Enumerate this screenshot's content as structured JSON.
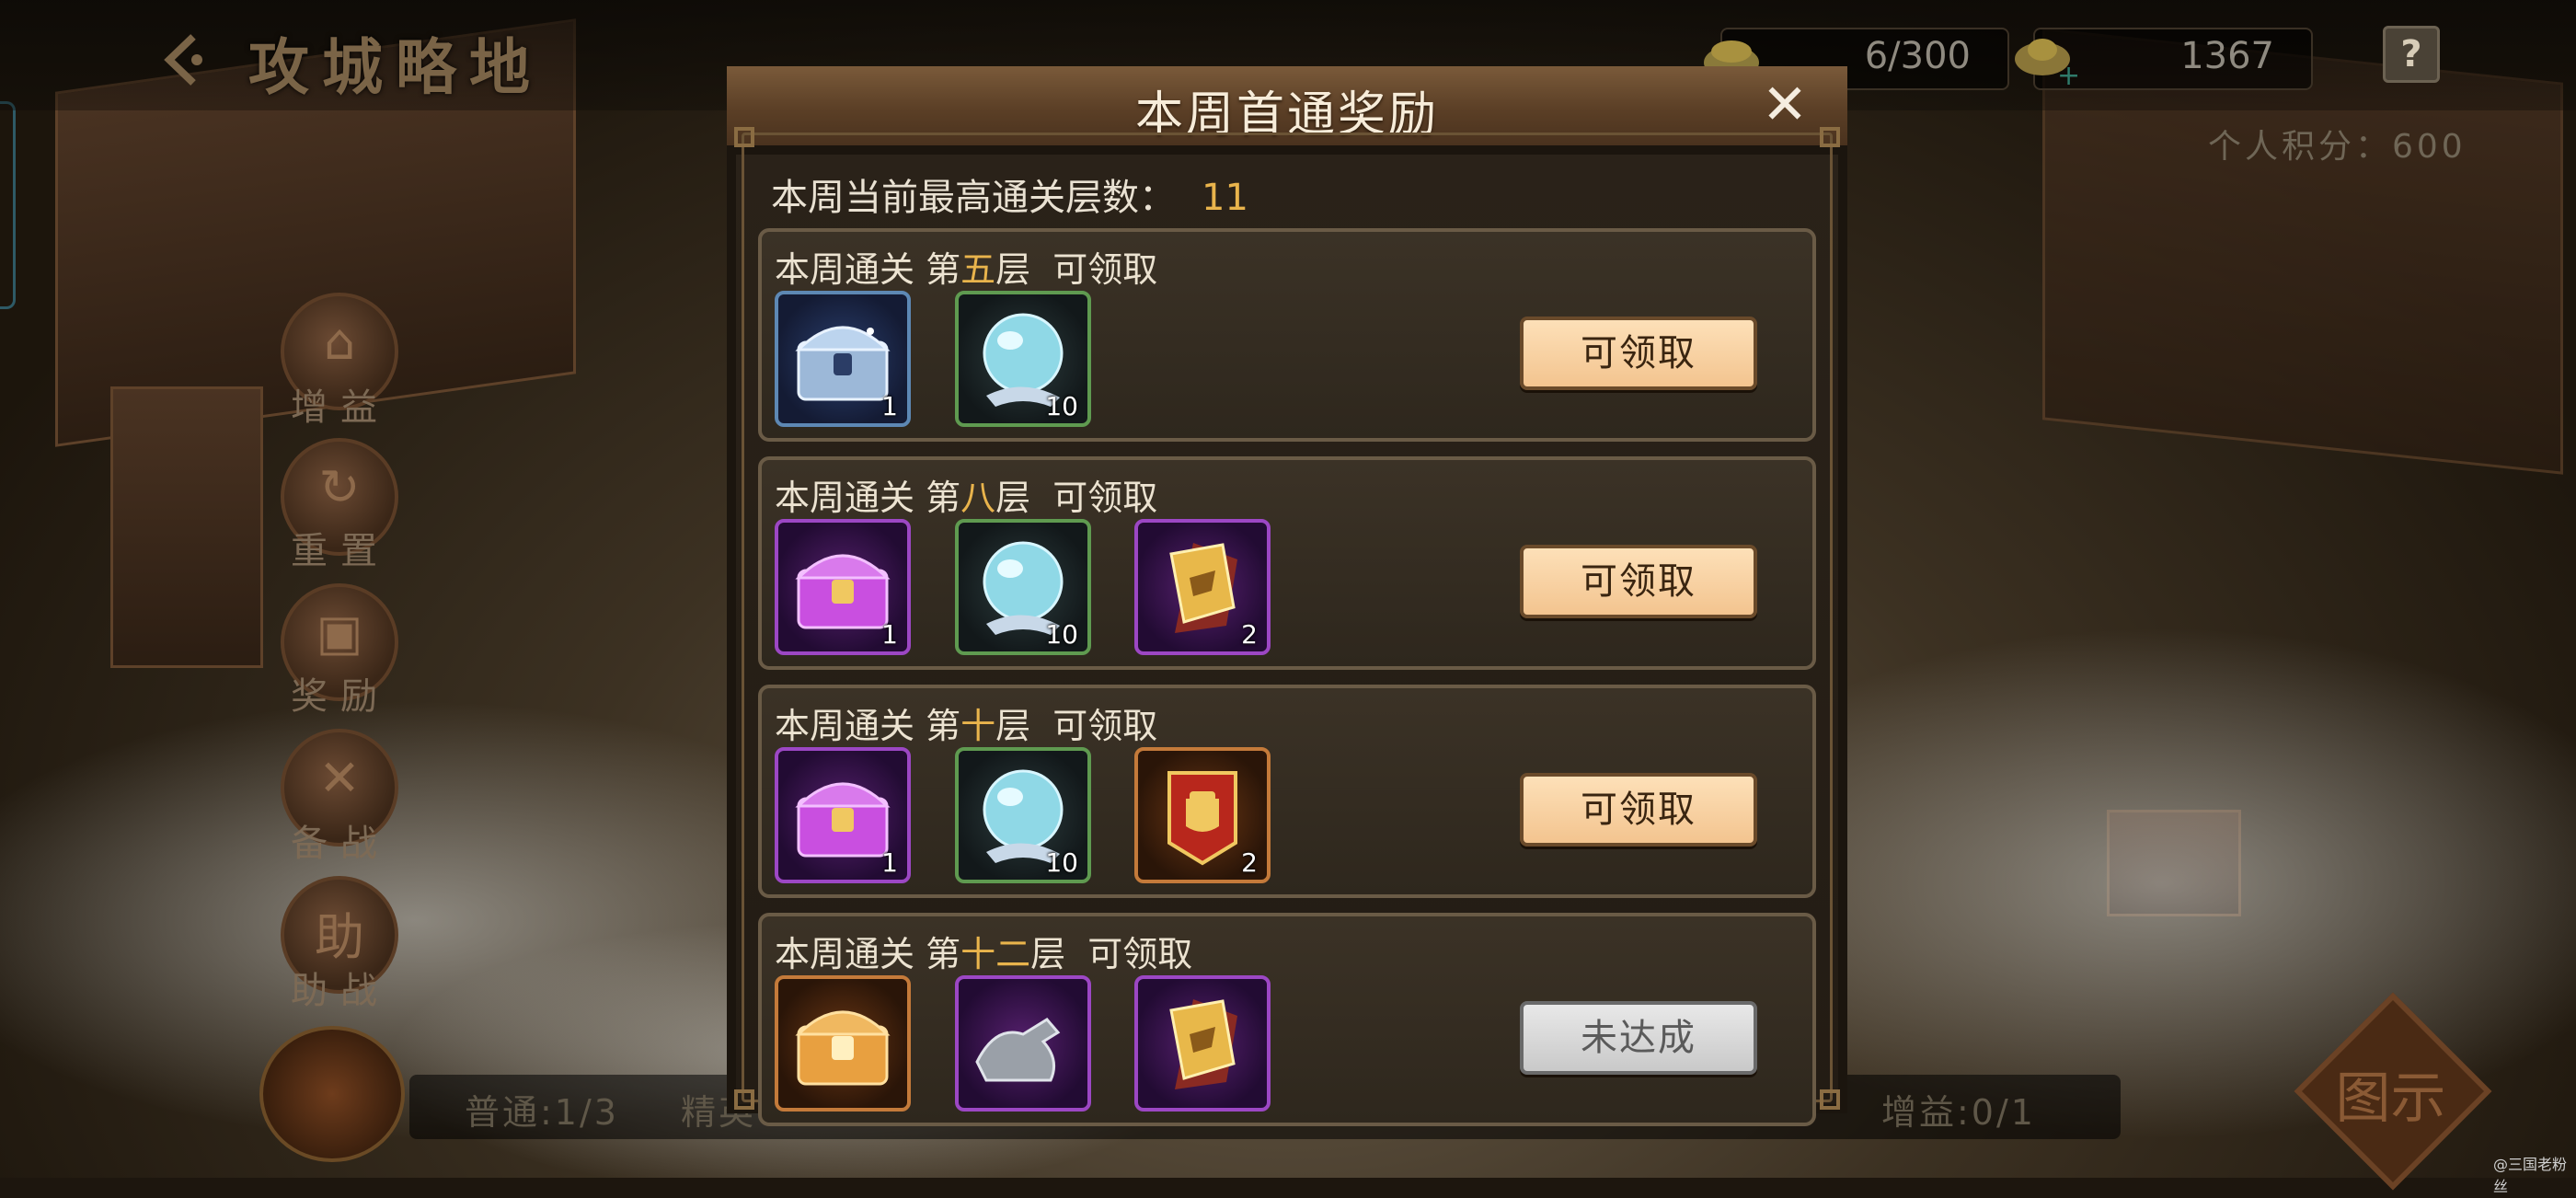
{
  "top": {
    "page_title": "攻城略地",
    "resource_1": "6/300",
    "resource_2": "1367",
    "help": "?",
    "score": "个人积分：600"
  },
  "sidebar": {
    "items": [
      {
        "label": "增益",
        "glyph": "⌂"
      },
      {
        "label": "重置",
        "glyph": "↻"
      },
      {
        "label": "奖励",
        "glyph": "▣"
      },
      {
        "label": "备战",
        "glyph": "✕"
      },
      {
        "label": "助战",
        "glyph": "助"
      }
    ]
  },
  "bottom": {
    "normal": "普通:1/3",
    "elite": "精英",
    "buff": "增益:0/1",
    "map_button": "图示"
  },
  "watermark": "@三国老粉丝",
  "modal": {
    "title": "本周首通奖励",
    "close": "✕",
    "summary_label": "本周当前最高通关层数：",
    "summary_value": "11",
    "tiers": [
      {
        "prefix": "本周通关 第",
        "floor": "五",
        "suffix": "层  可领取",
        "button": "可领取",
        "button_state": "active",
        "rewards": [
          {
            "icon": "silver-chest-icon",
            "quality": "blue",
            "qty": "1"
          },
          {
            "icon": "crystal-orb-icon",
            "quality": "green",
            "qty": "10"
          }
        ]
      },
      {
        "prefix": "本周通关 第",
        "floor": "八",
        "suffix": "层  可领取",
        "button": "可领取",
        "button_state": "active",
        "rewards": [
          {
            "icon": "purple-chest-icon",
            "quality": "purple",
            "qty": "1"
          },
          {
            "icon": "crystal-orb-icon",
            "quality": "green",
            "qty": "10"
          },
          {
            "icon": "gold-token-icon",
            "quality": "purple",
            "qty": "2"
          }
        ]
      },
      {
        "prefix": "本周通关 第",
        "floor": "十",
        "suffix": "层  可领取",
        "button": "可领取",
        "button_state": "active",
        "rewards": [
          {
            "icon": "purple-chest-icon",
            "quality": "purple",
            "qty": "1"
          },
          {
            "icon": "crystal-orb-icon",
            "quality": "green",
            "qty": "10"
          },
          {
            "icon": "fist-banner-icon",
            "quality": "orange",
            "qty": "2"
          }
        ]
      },
      {
        "prefix": "本周通关 第",
        "floor": "十二",
        "suffix": "层  可领取",
        "button": "未达成",
        "button_state": "disabled",
        "rewards": [
          {
            "icon": "orange-chest-icon",
            "quality": "orange",
            "qty": ""
          },
          {
            "icon": "war-horse-icon",
            "quality": "purple",
            "qty": ""
          },
          {
            "icon": "gold-token-icon",
            "quality": "purple",
            "qty": ""
          }
        ]
      }
    ]
  }
}
